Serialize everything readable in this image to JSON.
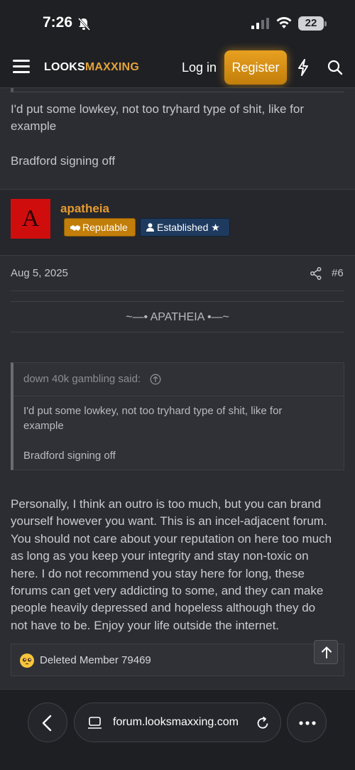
{
  "status_bar": {
    "time": "7:26",
    "battery": "22"
  },
  "navbar": {
    "logo_part1": "LOOKS",
    "logo_part2": "MAXXING",
    "login_label": "Log in",
    "register_label": "Register",
    "accent_color": "#e8a020"
  },
  "previous_post": {
    "text_line1": "I'd put some lowkey, not too tryhard type of shit, like for",
    "text_line2": "example",
    "sign_off": "Bradford signing off"
  },
  "post": {
    "author": "apatheia",
    "avatar_letter": "A",
    "badges": [
      {
        "label": "Reputable",
        "icon": "handshake-icon"
      },
      {
        "label": "Established",
        "icon": "user-icon"
      }
    ],
    "date": "Aug 5, 2025",
    "number": "#6",
    "signature": "~—• APATHEIA •—~",
    "quote": {
      "attribution": "down 40k gambling said:",
      "line1": "I'd put some lowkey, not too tryhard type of shit, like for",
      "line2": "example",
      "line3": "Bradford signing off"
    },
    "body_lines": [
      "Personally, I think an outro is too much, but you can brand",
      "yourself however you want. This is an incel-adjacent forum.",
      "You should not care about your reputation on here too much",
      "as long as you keep your integrity and stay non-toxic on",
      "here. I do not recommend you stay here for long, these",
      "forums can get very addicting to some, and they can make",
      "people heavily depressed and hopeless although they do",
      "not have to be. Enjoy your life outside the internet."
    ],
    "reaction_text": "Deleted Member 79469"
  },
  "browser": {
    "url": "forum.looksmaxxing.com"
  }
}
